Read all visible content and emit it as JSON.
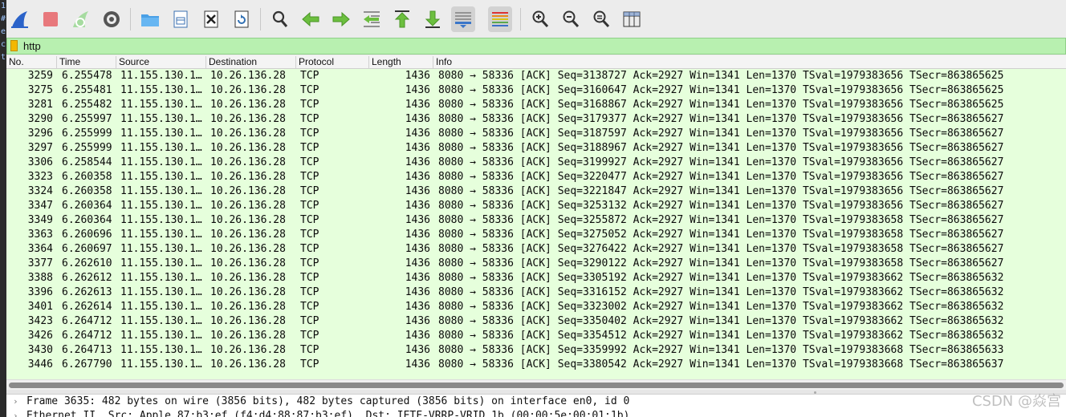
{
  "toolbar": {
    "buttons": [
      {
        "name": "start-capture-fin-icon"
      },
      {
        "name": "stop-capture-icon"
      },
      {
        "name": "restart-capture-icon"
      },
      {
        "name": "capture-options-gear-icon"
      },
      {
        "name": "open-file-folder-icon"
      },
      {
        "name": "save-file-icon"
      },
      {
        "name": "close-file-icon"
      },
      {
        "name": "reload-file-icon"
      },
      {
        "name": "find-packet-icon"
      },
      {
        "name": "go-back-arrow-icon"
      },
      {
        "name": "go-forward-arrow-icon"
      },
      {
        "name": "go-to-packet-icon"
      },
      {
        "name": "go-to-first-packet-icon"
      },
      {
        "name": "go-to-last-packet-icon"
      },
      {
        "name": "auto-scroll-icon"
      },
      {
        "name": "colorize-icon"
      },
      {
        "name": "zoom-in-icon"
      },
      {
        "name": "zoom-out-icon"
      },
      {
        "name": "normal-size-icon"
      },
      {
        "name": "resize-columns-icon"
      }
    ]
  },
  "filter": {
    "value": "http"
  },
  "packet_list": {
    "columns": [
      "No.",
      "Time",
      "Source",
      "Destination",
      "Protocol",
      "Length",
      "Info"
    ],
    "rows": [
      {
        "no": "3259",
        "time": "6.255478",
        "src": "11.155.130.1…",
        "dst": "10.26.136.28",
        "proto": "TCP",
        "len": "1436",
        "info": "8080 → 58336 [ACK] Seq=3138727 Ack=2927 Win=1341 Len=1370 TSval=1979383656 TSecr=863865625"
      },
      {
        "no": "3275",
        "time": "6.255481",
        "src": "11.155.130.1…",
        "dst": "10.26.136.28",
        "proto": "TCP",
        "len": "1436",
        "info": "8080 → 58336 [ACK] Seq=3160647 Ack=2927 Win=1341 Len=1370 TSval=1979383656 TSecr=863865625"
      },
      {
        "no": "3281",
        "time": "6.255482",
        "src": "11.155.130.1…",
        "dst": "10.26.136.28",
        "proto": "TCP",
        "len": "1436",
        "info": "8080 → 58336 [ACK] Seq=3168867 Ack=2927 Win=1341 Len=1370 TSval=1979383656 TSecr=863865625"
      },
      {
        "no": "3290",
        "time": "6.255997",
        "src": "11.155.130.1…",
        "dst": "10.26.136.28",
        "proto": "TCP",
        "len": "1436",
        "info": "8080 → 58336 [ACK] Seq=3179377 Ack=2927 Win=1341 Len=1370 TSval=1979383656 TSecr=863865627"
      },
      {
        "no": "3296",
        "time": "6.255999",
        "src": "11.155.130.1…",
        "dst": "10.26.136.28",
        "proto": "TCP",
        "len": "1436",
        "info": "8080 → 58336 [ACK] Seq=3187597 Ack=2927 Win=1341 Len=1370 TSval=1979383656 TSecr=863865627"
      },
      {
        "no": "3297",
        "time": "6.255999",
        "src": "11.155.130.1…",
        "dst": "10.26.136.28",
        "proto": "TCP",
        "len": "1436",
        "info": "8080 → 58336 [ACK] Seq=3188967 Ack=2927 Win=1341 Len=1370 TSval=1979383656 TSecr=863865627"
      },
      {
        "no": "3306",
        "time": "6.258544",
        "src": "11.155.130.1…",
        "dst": "10.26.136.28",
        "proto": "TCP",
        "len": "1436",
        "info": "8080 → 58336 [ACK] Seq=3199927 Ack=2927 Win=1341 Len=1370 TSval=1979383656 TSecr=863865627"
      },
      {
        "no": "3323",
        "time": "6.260358",
        "src": "11.155.130.1…",
        "dst": "10.26.136.28",
        "proto": "TCP",
        "len": "1436",
        "info": "8080 → 58336 [ACK] Seq=3220477 Ack=2927 Win=1341 Len=1370 TSval=1979383656 TSecr=863865627"
      },
      {
        "no": "3324",
        "time": "6.260358",
        "src": "11.155.130.1…",
        "dst": "10.26.136.28",
        "proto": "TCP",
        "len": "1436",
        "info": "8080 → 58336 [ACK] Seq=3221847 Ack=2927 Win=1341 Len=1370 TSval=1979383656 TSecr=863865627"
      },
      {
        "no": "3347",
        "time": "6.260364",
        "src": "11.155.130.1…",
        "dst": "10.26.136.28",
        "proto": "TCP",
        "len": "1436",
        "info": "8080 → 58336 [ACK] Seq=3253132 Ack=2927 Win=1341 Len=1370 TSval=1979383656 TSecr=863865627"
      },
      {
        "no": "3349",
        "time": "6.260364",
        "src": "11.155.130.1…",
        "dst": "10.26.136.28",
        "proto": "TCP",
        "len": "1436",
        "info": "8080 → 58336 [ACK] Seq=3255872 Ack=2927 Win=1341 Len=1370 TSval=1979383658 TSecr=863865627"
      },
      {
        "no": "3363",
        "time": "6.260696",
        "src": "11.155.130.1…",
        "dst": "10.26.136.28",
        "proto": "TCP",
        "len": "1436",
        "info": "8080 → 58336 [ACK] Seq=3275052 Ack=2927 Win=1341 Len=1370 TSval=1979383658 TSecr=863865627"
      },
      {
        "no": "3364",
        "time": "6.260697",
        "src": "11.155.130.1…",
        "dst": "10.26.136.28",
        "proto": "TCP",
        "len": "1436",
        "info": "8080 → 58336 [ACK] Seq=3276422 Ack=2927 Win=1341 Len=1370 TSval=1979383658 TSecr=863865627"
      },
      {
        "no": "3377",
        "time": "6.262610",
        "src": "11.155.130.1…",
        "dst": "10.26.136.28",
        "proto": "TCP",
        "len": "1436",
        "info": "8080 → 58336 [ACK] Seq=3290122 Ack=2927 Win=1341 Len=1370 TSval=1979383658 TSecr=863865627"
      },
      {
        "no": "3388",
        "time": "6.262612",
        "src": "11.155.130.1…",
        "dst": "10.26.136.28",
        "proto": "TCP",
        "len": "1436",
        "info": "8080 → 58336 [ACK] Seq=3305192 Ack=2927 Win=1341 Len=1370 TSval=1979383662 TSecr=863865632"
      },
      {
        "no": "3396",
        "time": "6.262613",
        "src": "11.155.130.1…",
        "dst": "10.26.136.28",
        "proto": "TCP",
        "len": "1436",
        "info": "8080 → 58336 [ACK] Seq=3316152 Ack=2927 Win=1341 Len=1370 TSval=1979383662 TSecr=863865632"
      },
      {
        "no": "3401",
        "time": "6.262614",
        "src": "11.155.130.1…",
        "dst": "10.26.136.28",
        "proto": "TCP",
        "len": "1436",
        "info": "8080 → 58336 [ACK] Seq=3323002 Ack=2927 Win=1341 Len=1370 TSval=1979383662 TSecr=863865632"
      },
      {
        "no": "3423",
        "time": "6.264712",
        "src": "11.155.130.1…",
        "dst": "10.26.136.28",
        "proto": "TCP",
        "len": "1436",
        "info": "8080 → 58336 [ACK] Seq=3350402 Ack=2927 Win=1341 Len=1370 TSval=1979383662 TSecr=863865632"
      },
      {
        "no": "3426",
        "time": "6.264712",
        "src": "11.155.130.1…",
        "dst": "10.26.136.28",
        "proto": "TCP",
        "len": "1436",
        "info": "8080 → 58336 [ACK] Seq=3354512 Ack=2927 Win=1341 Len=1370 TSval=1979383662 TSecr=863865632"
      },
      {
        "no": "3430",
        "time": "6.264713",
        "src": "11.155.130.1…",
        "dst": "10.26.136.28",
        "proto": "TCP",
        "len": "1436",
        "info": "8080 → 58336 [ACK] Seq=3359992 Ack=2927 Win=1341 Len=1370 TSval=1979383668 TSecr=863865633"
      },
      {
        "no": "3446",
        "time": "6.267790",
        "src": "11.155.130.1…",
        "dst": "10.26.136.28",
        "proto": "TCP",
        "len": "1436",
        "info": "8080 → 58336 [ACK] Seq=3380542 Ack=2927 Win=1341 Len=1370 TSval=1979383668 TSecr=863865637"
      }
    ]
  },
  "details": {
    "lines": [
      "Frame 3635: 482 bytes on wire (3856 bits), 482 bytes captured (3856 bits) on interface en0, id 0",
      "Ethernet II, Src: Apple_87:b3:ef (f4:d4:88:87:b3:ef), Dst: IETF-VRRP-VRID_1b (00:00:5e:00:01:1b)"
    ]
  },
  "watermark": "CSDN @焱宫",
  "colors": {
    "row_bg": "#e6ffdc",
    "filter_bg": "#b8f0b0",
    "toolbar_bg": "#ececec"
  }
}
